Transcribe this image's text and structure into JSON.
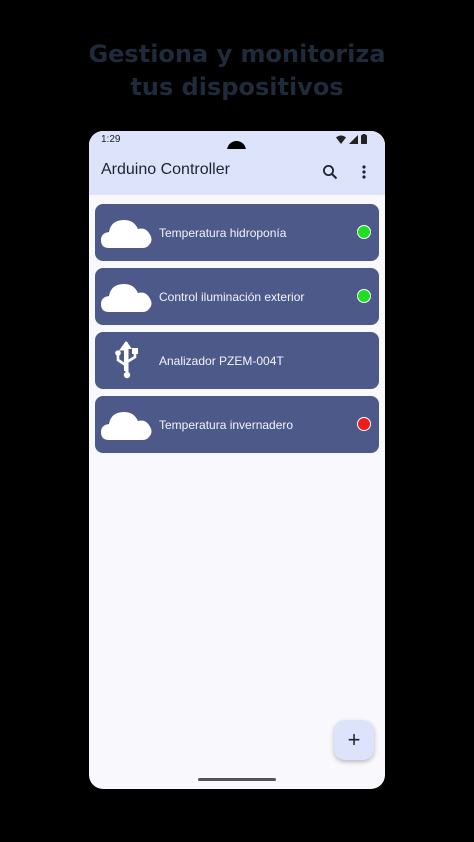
{
  "headline": {
    "line1": "Gestiona y monitoriza",
    "line2": "tus dispositivos"
  },
  "status_bar": {
    "time": "1:29",
    "icons": [
      "wifi-icon",
      "signal-icon",
      "battery-icon"
    ]
  },
  "app_bar": {
    "title": "Arduino Controller",
    "actions": [
      "search-icon",
      "more-vert-icon"
    ]
  },
  "devices": [
    {
      "name": "Temperatura hidroponía",
      "icon": "cloud-icon",
      "status": "online",
      "status_color": "#22dd22"
    },
    {
      "name": "Control iluminación exterior",
      "icon": "cloud-icon",
      "status": "online",
      "status_color": "#22dd22"
    },
    {
      "name": "Analizador PZEM-004T",
      "icon": "usb-icon",
      "status": "",
      "status_color": ""
    },
    {
      "name": "Temperatura invernadero",
      "icon": "cloud-icon",
      "status": "offline",
      "status_color": "#ee1c1c"
    }
  ],
  "fab": {
    "label": "+",
    "icon": "add-icon"
  },
  "colors": {
    "background": "#000000",
    "headline": "#1f2a3a",
    "app_bar": "#dde3fb",
    "card": "#4d5a89",
    "screen": "#f8f8fd"
  }
}
